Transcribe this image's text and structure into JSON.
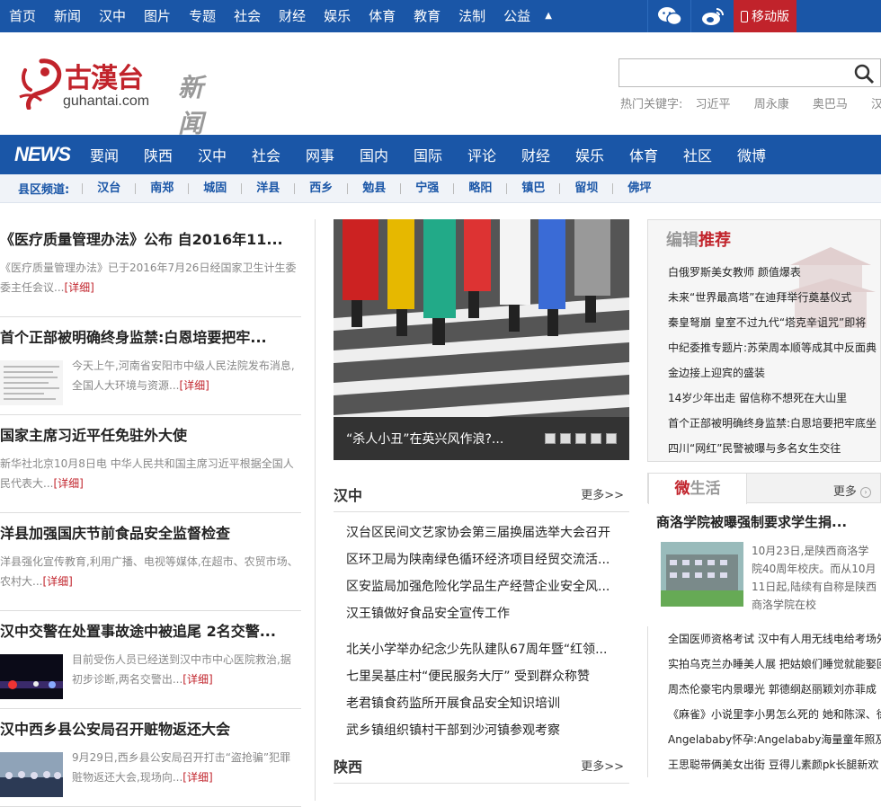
{
  "topnav": {
    "items": [
      "首页",
      "新闻",
      "汉中",
      "图片",
      "专题",
      "社会",
      "财经",
      "娱乐",
      "体育",
      "教育",
      "法制",
      "公益"
    ],
    "mobile": "移动版"
  },
  "header": {
    "logo_text": "古漢台",
    "logo_domain": "guhantai.com",
    "logo_sub": "新闻",
    "search_placeholder": "",
    "hot_label": "热门关键字:",
    "hot_words": [
      "习近平",
      "周永康",
      "奥巴马",
      "汉台"
    ]
  },
  "mainnav": {
    "brand": "NEWS",
    "items": [
      "要闻",
      "陕西",
      "汉中",
      "社会",
      "网事",
      "国内",
      "国际",
      "评论",
      "财经",
      "娱乐",
      "体育",
      "社区",
      "微博"
    ]
  },
  "subnav": {
    "label": "县区频道:",
    "items": [
      "汉台",
      "南郑",
      "城固",
      "洋县",
      "西乡",
      "勉县",
      "宁强",
      "略阳",
      "镇巴",
      "留坝",
      "佛坪"
    ]
  },
  "left": {
    "more": "[详细]",
    "articles": [
      {
        "title": "《医疗质量管理办法》公布 自2016年11...",
        "summary": "《医疗质量管理办法》已于2016年7月26日经国家卫生计生委委主任会议..."
      },
      {
        "title": "首个正部被明确终身监禁:白恩培要把牢...",
        "summary": "今天上午,河南省安阳市中级人民法院发布消息,全国人大环境与资源..."
      },
      {
        "title": "国家主席习近平任免驻外大使",
        "summary": "新华社北京10月8日电 中华人民共和国主席习近平根据全国人民代表大..."
      },
      {
        "title": "洋县加强国庆节前食品安全监督检查",
        "summary": "洋县强化宣传教育,利用广播、电视等媒体,在超市、农贸市场、农村大..."
      },
      {
        "title": "汉中交警在处置事故途中被追尾 2名交警...",
        "summary": "目前受伤人员已经送到汉中市中心医院救治,据初步诊断,两名交警出..."
      },
      {
        "title": "汉中西乡县公安局召开赃物返还大会",
        "summary": "9月29日,西乡县公安局召开打击“盗抢骗”犯罪赃物返还大会,现场向..."
      }
    ]
  },
  "slider": {
    "caption": "“杀人小丑”在英兴风作浪?..."
  },
  "hanzhong": {
    "title": "汉中",
    "more": "更多>>",
    "items": [
      "汉台区民间文艺家协会第三届换届选举大会召开",
      "区环卫局为陕南绿色循环经济项目经贸交流活...",
      "区安监局加强危险化学品生产经营企业安全风...",
      "汉王镇做好食品安全宣传工作",
      "北关小学举办纪念少先队建队67周年暨“红领...",
      "七里吴基庄村“便民服务大厅” 受到群众称赞",
      "老君镇食药监所开展食品安全知识培训",
      "武乡镇组织镇村干部到沙河镇参观考察"
    ]
  },
  "shaanxi": {
    "title": "陕西",
    "more": "更多>>"
  },
  "bianji": {
    "title_a": "编辑",
    "title_b": "推荐",
    "items": [
      "白俄罗斯美女教师 颜值爆表",
      "未来“世界最高塔”在迪拜举行奠基仪式",
      "秦皇弩崩 皇室不过九代“塔克辛诅咒”即将",
      "中纪委推专题片:苏荣周本顺等成其中反面典",
      "金边接上迎宾的盛装",
      "14岁少年出走 留信称不想死在大山里",
      "首个正部被明确终身监禁:白恩培要把牢底坐",
      "四川“网红”民警被曝与多名女生交往"
    ]
  },
  "weishenghuo": {
    "title_a": "微",
    "title_b": "生活",
    "more": "更多",
    "headline": "商洛学院被曝强制要求学生捐...",
    "summary": "10月23日,是陕西商洛学院40周年校庆。而从10月11日起,陆续有自称是陕西商洛学院在校",
    "items": [
      "全国医师资格考试 汉中有人用无线电给考场外",
      "实拍乌克兰办睡美人展 把姑娘们睡觉就能娶回",
      "周杰伦豪宅内景曝光 郭德纲赵丽颖刘亦菲成",
      "《麻雀》小说里李小男怎么死的 她和陈深、徐",
      "Angelababy怀孕:Angelababy海量童年照及少",
      "王思聪带俩美女出街 豆得儿素颜pk长腿新欢"
    ]
  },
  "colors": {
    "brand_blue": "#1a56a7",
    "accent_red": "#c1232b"
  }
}
